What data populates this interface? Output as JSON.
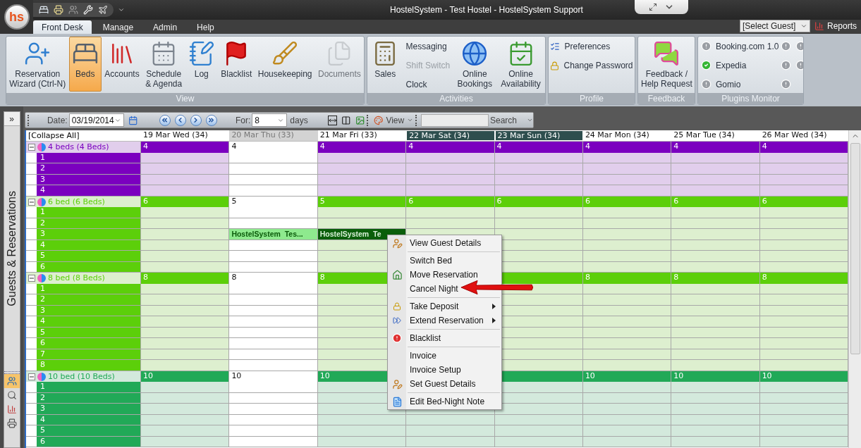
{
  "app_logo": "hs",
  "window": {
    "title": "HostelSystem - Test Hostel - HostelSystem Support"
  },
  "ribbon_tabs": [
    {
      "label": "Front Desk",
      "selected": true
    },
    {
      "label": "Manage",
      "selected": false
    },
    {
      "label": "Admin",
      "selected": false
    },
    {
      "label": "Help",
      "selected": false
    }
  ],
  "guest_select": {
    "value": "[Select Guest]"
  },
  "reports_button": "Reports",
  "ribbon_groups": [
    {
      "title": "View",
      "items": [
        {
          "kind": "large",
          "label": "Reservation\nWizard (Ctrl-N)",
          "selected": false,
          "disabled": false
        },
        {
          "kind": "large",
          "label": "Beds",
          "selected": true,
          "disabled": false
        },
        {
          "kind": "large",
          "label": "Accounts",
          "selected": false,
          "disabled": false
        },
        {
          "kind": "large",
          "label": "Schedule\n& Agenda",
          "selected": false,
          "disabled": false
        },
        {
          "kind": "large",
          "label": "Log",
          "selected": false,
          "disabled": false
        },
        {
          "kind": "large",
          "label": "Blacklist",
          "selected": false,
          "disabled": false
        },
        {
          "kind": "large",
          "label": "Housekeeping",
          "selected": false,
          "disabled": false
        },
        {
          "kind": "large",
          "label": "Documents",
          "selected": false,
          "disabled": true
        }
      ]
    },
    {
      "title": "Activities",
      "items": [
        {
          "kind": "large",
          "label": "Sales"
        },
        {
          "kind": "stack",
          "items": [
            {
              "label": "Messaging",
              "disabled": false
            },
            {
              "label": "Shift Switch",
              "disabled": true
            },
            {
              "label": "Clock",
              "disabled": false
            }
          ]
        },
        {
          "kind": "large",
          "label": "Online\nBookings"
        },
        {
          "kind": "large",
          "label": "Online\nAvailability"
        }
      ]
    },
    {
      "title": "Profile",
      "items": [
        {
          "kind": "stack",
          "items": [
            {
              "label": "Preferences",
              "disabled": false
            },
            {
              "label": "Change Password",
              "disabled": false
            }
          ]
        }
      ]
    },
    {
      "title": "Feedback",
      "items": [
        {
          "kind": "large",
          "label": "Feedback /\nHelp Request"
        }
      ]
    },
    {
      "title": "Plugins Monitor",
      "items": [
        {
          "kind": "plugins",
          "items": [
            {
              "label": "Booking.com 1.0",
              "ok": false,
              "indicators": [
                {
                  "ok": false
                },
                {
                  "ok": false
                }
              ]
            },
            {
              "label": "Expedia",
              "ok": true,
              "indicators": [
                {
                  "ok": false
                },
                {
                  "ok": false
                }
              ]
            },
            {
              "label": "Gomio",
              "ok": false,
              "indicators": [
                {
                  "ok": false
                }
              ]
            }
          ]
        }
      ]
    }
  ],
  "side_panel": {
    "expand_button": "»",
    "title": "Guests & Reservations",
    "tabs": [
      {
        "selected": true
      },
      {
        "selected": false
      },
      {
        "selected": false
      },
      {
        "selected": false
      }
    ]
  },
  "toolbar": {
    "date_label": "Date:",
    "date": "03/19/2014",
    "for_label": "For:",
    "days_value": "8",
    "days_label": "days",
    "view_button": "View",
    "search_button": "Search"
  },
  "grid": {
    "collapse_all": "[Collapse All]",
    "days": [
      {
        "label": "19 Mar Wed (34)",
        "kind": "weekday"
      },
      {
        "label": "20 Mar Thu (33)",
        "kind": "today"
      },
      {
        "label": "21 Mar Fri (33)",
        "kind": "weekday"
      },
      {
        "label": "22 Mar Sat (34)",
        "kind": "weekend"
      },
      {
        "label": "23 Mar Sun (34)",
        "kind": "weekend"
      },
      {
        "label": "24 Mar Mon (34)",
        "kind": "weekday"
      },
      {
        "label": "25 Mar Tue (34)",
        "kind": "weekday"
      },
      {
        "label": "26 Mar Wed (34)",
        "kind": "weekday"
      }
    ],
    "groups": [
      {
        "label": "4 beds (4 Beds)",
        "color": "#7b00bf",
        "expanded": true,
        "counts": [
          {
            "kind": "count",
            "text": "4"
          },
          {
            "kind": "count",
            "text": "4"
          },
          {
            "kind": "count",
            "text": "4"
          },
          {
            "kind": "count",
            "text": "4"
          },
          {
            "kind": "count",
            "text": "4"
          },
          {
            "kind": "count",
            "text": "4"
          },
          {
            "kind": "count",
            "text": "4"
          },
          {
            "kind": "count",
            "text": "4"
          }
        ],
        "beds": [
          {
            "label": "1"
          },
          {
            "label": "2"
          },
          {
            "label": "3"
          },
          {
            "label": "4"
          }
        ]
      },
      {
        "label": "6 bed (6 Beds)",
        "color": "#5ccf0a",
        "expanded": true,
        "counts": [
          {
            "kind": "count",
            "text": "6"
          },
          {
            "kind": "count",
            "text": "5"
          },
          {
            "kind": "count",
            "text": "5"
          },
          {
            "kind": "count",
            "text": "6"
          },
          {
            "kind": "count",
            "text": "6"
          },
          {
            "kind": "count",
            "text": "6"
          },
          {
            "kind": "count",
            "text": "6"
          },
          {
            "kind": "count",
            "text": "6"
          }
        ],
        "beds": [
          {
            "label": "1"
          },
          {
            "label": "2"
          },
          {
            "label": "3",
            "bookings": [
              {
                "kind": "empty"
              },
              {
                "kind": "booking",
                "text": "HostelSystem  Tes...",
                "selected": false
              },
              {
                "kind": "booking",
                "text": "HostelSystem  Te",
                "selected": true
              }
            ]
          },
          {
            "label": "4"
          },
          {
            "label": "5"
          },
          {
            "label": "6"
          }
        ]
      },
      {
        "label": "8 bed (8 Beds)",
        "color": "#5ccf0a",
        "expanded": true,
        "counts": [
          {
            "kind": "count",
            "text": "8"
          },
          {
            "kind": "count",
            "text": "8"
          },
          {
            "kind": "count",
            "text": "8"
          },
          {
            "kind": "covered"
          },
          {
            "kind": "covered"
          },
          {
            "kind": "count",
            "text": "8"
          },
          {
            "kind": "count",
            "text": "8"
          },
          {
            "kind": "count",
            "text": "8"
          }
        ],
        "beds": [
          {
            "label": "1"
          },
          {
            "label": "2"
          },
          {
            "label": "3"
          },
          {
            "label": "4"
          },
          {
            "label": "5"
          },
          {
            "label": "6"
          },
          {
            "label": "7"
          },
          {
            "label": "8"
          }
        ]
      },
      {
        "label": "10 bed (10 Beds)",
        "color": "#21a957",
        "expanded": true,
        "counts": [
          {
            "kind": "count",
            "text": "10"
          },
          {
            "kind": "count",
            "text": "10"
          },
          {
            "kind": "count",
            "text": "10"
          },
          {
            "kind": "covered"
          },
          {
            "kind": "covered"
          },
          {
            "kind": "count",
            "text": "10"
          },
          {
            "kind": "count",
            "text": "10"
          },
          {
            "kind": "count",
            "text": "10"
          }
        ],
        "beds": [
          {
            "label": "1"
          },
          {
            "label": "2"
          },
          {
            "label": "3"
          },
          {
            "label": "4"
          },
          {
            "label": "5"
          },
          {
            "label": "6"
          }
        ]
      }
    ]
  },
  "context_menu": {
    "items": [
      {
        "kind": "item",
        "label": "View Guest Details",
        "submenu": false
      },
      {
        "kind": "separator"
      },
      {
        "kind": "item",
        "label": "Switch Bed",
        "submenu": false
      },
      {
        "kind": "item",
        "label": "Move Reservation",
        "submenu": false
      },
      {
        "kind": "item",
        "label": "Cancel Night",
        "submenu": false
      },
      {
        "kind": "separator"
      },
      {
        "kind": "item",
        "label": "Take Deposit",
        "submenu": true
      },
      {
        "kind": "item",
        "label": "Extend Reservation",
        "submenu": true
      },
      {
        "kind": "separator"
      },
      {
        "kind": "item",
        "label": "Blacklist",
        "submenu": false
      },
      {
        "kind": "separator"
      },
      {
        "kind": "item",
        "label": "Invoice",
        "submenu": false
      },
      {
        "kind": "item",
        "label": "Invoice Setup",
        "submenu": false
      },
      {
        "kind": "item",
        "label": "Set Guest Details",
        "submenu": false
      },
      {
        "kind": "separator"
      },
      {
        "kind": "item",
        "label": "Edit Bed-Night Note",
        "submenu": false
      }
    ]
  }
}
